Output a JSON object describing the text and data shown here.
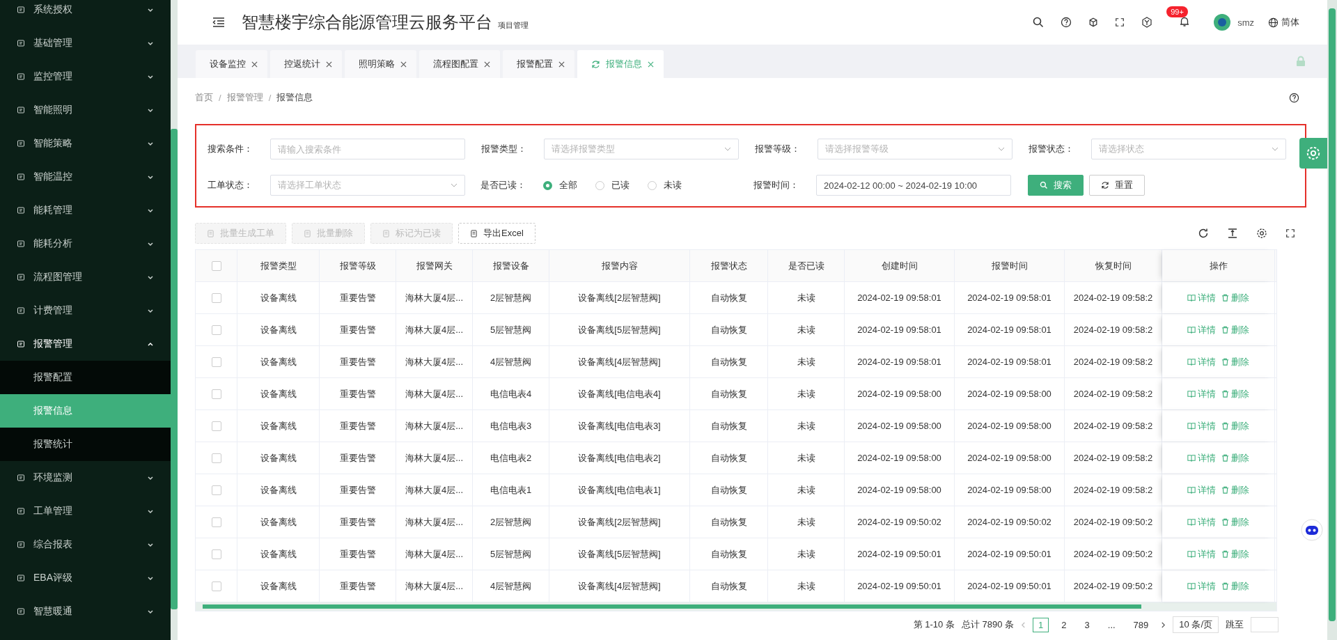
{
  "sidebar": {
    "items": [
      {
        "label": "系统授权",
        "expanded": false
      },
      {
        "label": "基础管理",
        "expanded": false
      },
      {
        "label": "监控管理",
        "expanded": false
      },
      {
        "label": "智能照明",
        "expanded": false
      },
      {
        "label": "智能策略",
        "expanded": false
      },
      {
        "label": "智能温控",
        "expanded": false
      },
      {
        "label": "能耗管理",
        "expanded": false
      },
      {
        "label": "能耗分析",
        "expanded": false
      },
      {
        "label": "流程图管理",
        "expanded": false
      },
      {
        "label": "计费管理",
        "expanded": false
      },
      {
        "label": "报警管理",
        "expanded": true,
        "children": [
          {
            "label": "报警配置",
            "selected": false
          },
          {
            "label": "报警信息",
            "selected": true
          },
          {
            "label": "报警统计",
            "selected": false
          }
        ]
      },
      {
        "label": "环境监测",
        "expanded": false
      },
      {
        "label": "工单管理",
        "expanded": false
      },
      {
        "label": "综合报表",
        "expanded": false
      },
      {
        "label": "EBA评级",
        "expanded": false
      },
      {
        "label": "智慧暖通",
        "expanded": false
      }
    ]
  },
  "header": {
    "title": "智慧楼宇综合能源管理云服务平台",
    "subtitle": "项目管理",
    "badge": "99+",
    "user": "smz",
    "language": "简体"
  },
  "tabs": [
    {
      "label": "设备监控",
      "selected": false
    },
    {
      "label": "控返统计",
      "selected": false
    },
    {
      "label": "照明策略",
      "selected": false
    },
    {
      "label": "流程图配置",
      "selected": false
    },
    {
      "label": "报警配置",
      "selected": false
    },
    {
      "label": "报警信息",
      "selected": true
    }
  ],
  "breadcrumb": {
    "items": [
      "首页",
      "报警管理",
      "报警信息"
    ],
    "separator": "/"
  },
  "filters": {
    "search": {
      "label": "搜索条件：",
      "placeholder": "请输入搜索条件"
    },
    "alarm_type": {
      "label": "报警类型：",
      "placeholder": "请选择报警类型"
    },
    "alarm_level": {
      "label": "报警等级：",
      "placeholder": "请选择报警等级"
    },
    "alarm_status": {
      "label": "报警状态：",
      "placeholder": "请选择状态"
    },
    "order_status": {
      "label": "工单状态：",
      "placeholder": "请选择工单状态"
    },
    "read": {
      "label": "是否已读：",
      "options": [
        {
          "label": "全部",
          "selected": true
        },
        {
          "label": "已读",
          "selected": false
        },
        {
          "label": "未读",
          "selected": false
        }
      ]
    },
    "time": {
      "label": "报警时间：",
      "value": "2024-02-12 00:00 ~ 2024-02-19 10:00"
    },
    "search_button": "搜索",
    "reset_button": "重置"
  },
  "toolbar": [
    {
      "label": "批量生成工单",
      "disabled": true
    },
    {
      "label": "批量删除",
      "disabled": true
    },
    {
      "label": "标记为已读",
      "disabled": true
    },
    {
      "label": "导出Excel",
      "disabled": false
    }
  ],
  "table": {
    "all_checked": false,
    "columns": [
      "报警类型",
      "报警等级",
      "报警网关",
      "报警设备",
      "报警内容",
      "报警状态",
      "是否已读",
      "创建时间",
      "报警时间",
      "恢复时间",
      "操作"
    ],
    "rows": [
      {
        "checked": false,
        "cells": [
          "设备离线",
          "重要告警",
          "海林大厦4层...",
          "2层智慧阀",
          "设备离线[2层智慧阀]",
          "自动恢复",
          "未读",
          "2024-02-19 09:58:01",
          "2024-02-19 09:58:01",
          "2024-02-19 09:58:2"
        ],
        "actions": [
          "详情",
          "删除"
        ]
      },
      {
        "checked": false,
        "cells": [
          "设备离线",
          "重要告警",
          "海林大厦4层...",
          "5层智慧阀",
          "设备离线[5层智慧阀]",
          "自动恢复",
          "未读",
          "2024-02-19 09:58:01",
          "2024-02-19 09:58:01",
          "2024-02-19 09:58:2"
        ],
        "actions": [
          "详情",
          "删除"
        ]
      },
      {
        "checked": false,
        "cells": [
          "设备离线",
          "重要告警",
          "海林大厦4层...",
          "4层智慧阀",
          "设备离线[4层智慧阀]",
          "自动恢复",
          "未读",
          "2024-02-19 09:58:01",
          "2024-02-19 09:58:01",
          "2024-02-19 09:58:2"
        ],
        "actions": [
          "详情",
          "删除"
        ]
      },
      {
        "checked": false,
        "cells": [
          "设备离线",
          "重要告警",
          "海林大厦4层...",
          "电信电表4",
          "设备离线[电信电表4]",
          "自动恢复",
          "未读",
          "2024-02-19 09:58:00",
          "2024-02-19 09:58:00",
          "2024-02-19 09:58:2"
        ],
        "actions": [
          "详情",
          "删除"
        ]
      },
      {
        "checked": false,
        "cells": [
          "设备离线",
          "重要告警",
          "海林大厦4层...",
          "电信电表3",
          "设备离线[电信电表3]",
          "自动恢复",
          "未读",
          "2024-02-19 09:58:00",
          "2024-02-19 09:58:00",
          "2024-02-19 09:58:2"
        ],
        "actions": [
          "详情",
          "删除"
        ]
      },
      {
        "checked": false,
        "cells": [
          "设备离线",
          "重要告警",
          "海林大厦4层...",
          "电信电表2",
          "设备离线[电信电表2]",
          "自动恢复",
          "未读",
          "2024-02-19 09:58:00",
          "2024-02-19 09:58:00",
          "2024-02-19 09:58:2"
        ],
        "actions": [
          "详情",
          "删除"
        ]
      },
      {
        "checked": false,
        "cells": [
          "设备离线",
          "重要告警",
          "海林大厦4层...",
          "电信电表1",
          "设备离线[电信电表1]",
          "自动恢复",
          "未读",
          "2024-02-19 09:58:00",
          "2024-02-19 09:58:00",
          "2024-02-19 09:58:2"
        ],
        "actions": [
          "详情",
          "删除"
        ]
      },
      {
        "checked": false,
        "cells": [
          "设备离线",
          "重要告警",
          "海林大厦4层...",
          "2层智慧阀",
          "设备离线[2层智慧阀]",
          "自动恢复",
          "未读",
          "2024-02-19 09:50:02",
          "2024-02-19 09:50:02",
          "2024-02-19 09:50:2"
        ],
        "actions": [
          "详情",
          "删除"
        ]
      },
      {
        "checked": false,
        "cells": [
          "设备离线",
          "重要告警",
          "海林大厦4层...",
          "5层智慧阀",
          "设备离线[5层智慧阀]",
          "自动恢复",
          "未读",
          "2024-02-19 09:50:01",
          "2024-02-19 09:50:01",
          "2024-02-19 09:50:2"
        ],
        "actions": [
          "详情",
          "删除"
        ]
      },
      {
        "checked": false,
        "cells": [
          "设备离线",
          "重要告警",
          "海林大厦4层...",
          "4层智慧阀",
          "设备离线[4层智慧阀]",
          "自动恢复",
          "未读",
          "2024-02-19 09:50:01",
          "2024-02-19 09:50:01",
          "2024-02-19 09:50:2"
        ],
        "actions": [
          "详情",
          "删除"
        ]
      }
    ]
  },
  "pagination": {
    "range": "第 1-10 条",
    "total": "总计 7890 条",
    "pages": [
      {
        "label": "1",
        "selected": true
      },
      {
        "label": "2",
        "selected": false
      },
      {
        "label": "3",
        "selected": false
      },
      {
        "label": "...",
        "selected": false
      },
      {
        "label": "789",
        "selected": false
      }
    ],
    "page_size": "10 条/页",
    "jump": "跳至"
  }
}
